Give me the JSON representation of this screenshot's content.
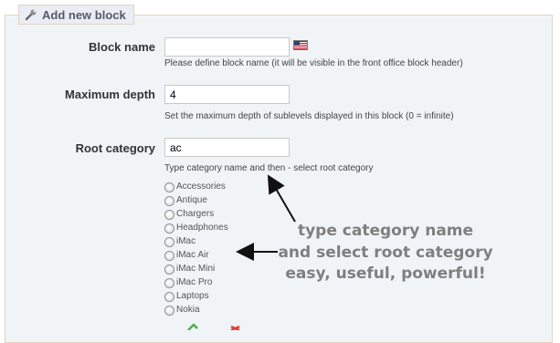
{
  "panel": {
    "title": "Add new block",
    "title_icon": "wrench-icon"
  },
  "fields": {
    "block_name": {
      "label": "Block name",
      "value": "",
      "help": "Please define block name (it will be visible in the front office block header)",
      "lang_flag": "us-flag-icon"
    },
    "max_depth": {
      "label": "Maximum depth",
      "value": "4",
      "help": "Set the maximum depth of sublevels displayed in this block (0 = infinite)"
    },
    "root_category": {
      "label": "Root category",
      "value": "ac",
      "help": "Type category name and then - select root category",
      "options": [
        "Accessories",
        "Antique",
        "Chargers",
        "Headphones",
        "iMac",
        "iMac Air",
        "iMac Mini",
        "iMac Pro",
        "Laptops",
        "Nokia"
      ]
    }
  },
  "annotation": {
    "line1": "type category name",
    "line2": "and select root category",
    "line3": "easy, useful, powerful!",
    "color": "#7f7f7f"
  },
  "colors": {
    "panel_bg": "#f0f4f7",
    "panel_border": "#dfd5c3",
    "legend_text": "#585a69"
  }
}
